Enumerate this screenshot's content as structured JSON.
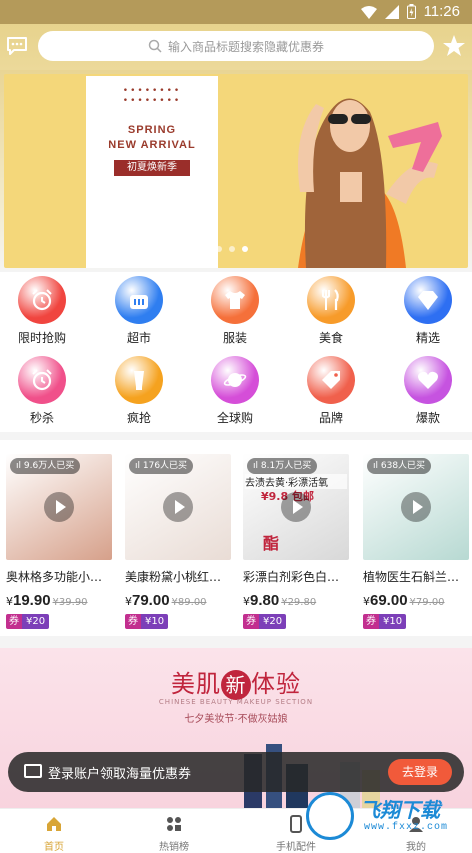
{
  "status_bar": {
    "time": "11:26"
  },
  "search": {
    "placeholder": "输入商品标题搜索隐藏优惠券"
  },
  "banner": {
    "dots": "••••••••",
    "line1": "SPRING",
    "line2": "NEW ARRIVAL",
    "tag": "初夏焕新季",
    "pages": 3,
    "active_page": 3
  },
  "categories": [
    {
      "label": "限时抢购",
      "icon": "alarm-clock-icon",
      "color": "#f0453f"
    },
    {
      "label": "超市",
      "icon": "shopping-basket-icon",
      "color": "#2f7ef0"
    },
    {
      "label": "服装",
      "icon": "tshirt-icon",
      "color": "#f5703a"
    },
    {
      "label": "美食",
      "icon": "fork-knife-icon",
      "color": "#f79b2a"
    },
    {
      "label": "精选",
      "icon": "diamond-icon",
      "color": "#2e6ff2"
    },
    {
      "label": "秒杀",
      "icon": "alarm-clock-icon",
      "color": "#f0508a"
    },
    {
      "label": "疯抢",
      "icon": "tube-icon",
      "color": "#f5a21f"
    },
    {
      "label": "全球购",
      "icon": "planet-icon",
      "color": "#d54ed8"
    },
    {
      "label": "品牌",
      "icon": "price-tag-icon",
      "color": "#f0604c"
    },
    {
      "label": "爆款",
      "icon": "heart-icon",
      "color": "#c653e0"
    }
  ],
  "products": [
    {
      "badge": "9.6万人已买",
      "name": "奥林格多功能小…",
      "currency": "¥",
      "price": "19.90",
      "old_price": "¥39.90",
      "coupon_label": "券",
      "coupon_value": "¥20",
      "thumb": "#d6a08a"
    },
    {
      "badge": "176人已买",
      "name": "美康粉黛小桃红…",
      "currency": "¥",
      "price": "79.00",
      "old_price": "¥89.00",
      "coupon_label": "券",
      "coupon_value": "¥10",
      "thumb": "#e9dcd5"
    },
    {
      "badge": "8.1万人已买",
      "name": "彩漂白剂彩色白…",
      "currency": "¥",
      "price": "9.80",
      "old_price": "¥29.80",
      "coupon_label": "券",
      "coupon_value": "¥20",
      "thumb": "#d8d8d8",
      "overlay_text": "去渍去黄·彩漂活氧",
      "overlay_price": "¥9.8 包邮",
      "overlay_char": "酯"
    },
    {
      "badge": "638人已买",
      "name": "植物医生石斛兰…",
      "currency": "¥",
      "price": "69.00",
      "old_price": "¥79.00",
      "coupon_label": "券",
      "coupon_value": "¥10",
      "thumb": "#b7d9d2"
    }
  ],
  "promo": {
    "title_left": "美肌",
    "title_mid": "新",
    "title_right": "体验",
    "subtitle_en": "CHINESE BEAUTY MAKEUP SECTION",
    "subtitle": "七夕美妆节·不做灰姑娘"
  },
  "login_bar": {
    "text": "登录账户领取海量优惠券",
    "button": "去登录"
  },
  "tabs": [
    {
      "label": "首页",
      "icon": "home-icon",
      "active": true
    },
    {
      "label": "热销榜",
      "icon": "grid-icon",
      "active": false
    },
    {
      "label": "手机配件",
      "icon": "phone-icon",
      "active": false
    },
    {
      "label": "我的",
      "icon": "user-icon",
      "active": false
    }
  ],
  "watermark": {
    "title": "飞翔下载",
    "url": "www.fxxz.com"
  },
  "colors": {
    "accent": "#e8d28c",
    "active_tab": "#d8a537",
    "login_button": "#f15a3a"
  }
}
